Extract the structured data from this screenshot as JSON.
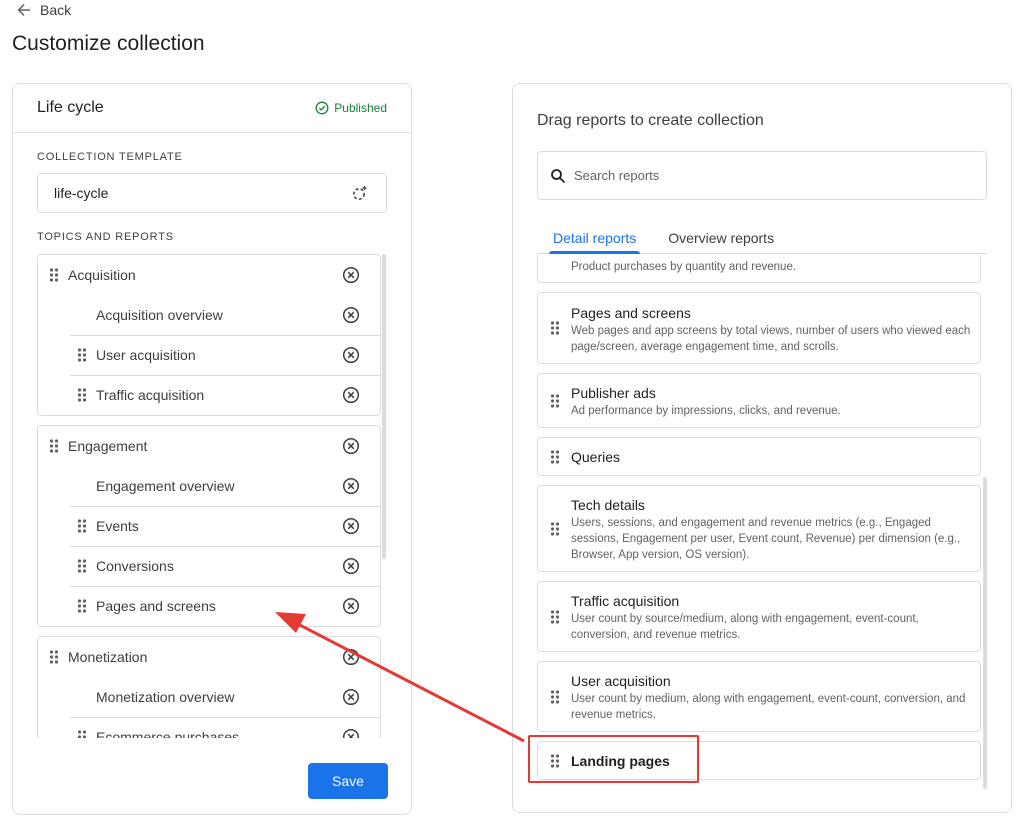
{
  "header": {
    "back_label": "Back",
    "page_title": "Customize collection"
  },
  "left_panel": {
    "title": "Life cycle",
    "status": "Published",
    "collection_template_label": "COLLECTION TEMPLATE",
    "template_value": "life-cycle",
    "topics_label": "TOPICS AND REPORTS",
    "topics": [
      {
        "name": "Acquisition",
        "reports": [
          "Acquisition overview",
          "User acquisition",
          "Traffic acquisition"
        ]
      },
      {
        "name": "Engagement",
        "reports": [
          "Engagement overview",
          "Events",
          "Conversions",
          "Pages and screens"
        ]
      },
      {
        "name": "Monetization",
        "reports": [
          "Monetization overview",
          "Ecommerce purchases"
        ]
      }
    ],
    "save_label": "Save"
  },
  "right_panel": {
    "title": "Drag reports to create collection",
    "search_placeholder": "Search reports",
    "tabs": [
      "Detail reports",
      "Overview reports"
    ],
    "active_tab": "Detail reports",
    "reports": [
      {
        "title": "",
        "description": "Product purchases by quantity and revenue."
      },
      {
        "title": "Pages and screens",
        "description": "Web pages and app screens by total views, number of users who viewed each page/screen, average engagement time, and scrolls."
      },
      {
        "title": "Publisher ads",
        "description": "Ad performance by impressions, clicks, and revenue."
      },
      {
        "title": "Queries",
        "description": ""
      },
      {
        "title": "Tech details",
        "description": "Users, sessions, and engagement and revenue metrics (e.g., Engaged sessions, Engagement per user, Event count, Revenue) per dimension (e.g., Browser, App version, OS version)."
      },
      {
        "title": "Traffic acquisition",
        "description": "User count by source/medium, along with engagement, event-count, conversion, and revenue metrics."
      },
      {
        "title": "User acquisition",
        "description": "User count by medium, along with engagement, event-count, conversion, and revenue metrics."
      },
      {
        "title": "Landing pages",
        "description": ""
      }
    ]
  },
  "annotation": {
    "highlight_color": "#e53935",
    "highlighted_report": "Landing pages"
  },
  "colors": {
    "accent": "#1a73e8",
    "published": "#188038",
    "border": "#dadce0"
  },
  "icons": {
    "back": "arrow-left-icon",
    "published": "check-circle-icon",
    "template": "template-sparkle-icon",
    "drag": "drag-handle-icon",
    "remove": "remove-circle-icon",
    "search": "search-icon"
  }
}
